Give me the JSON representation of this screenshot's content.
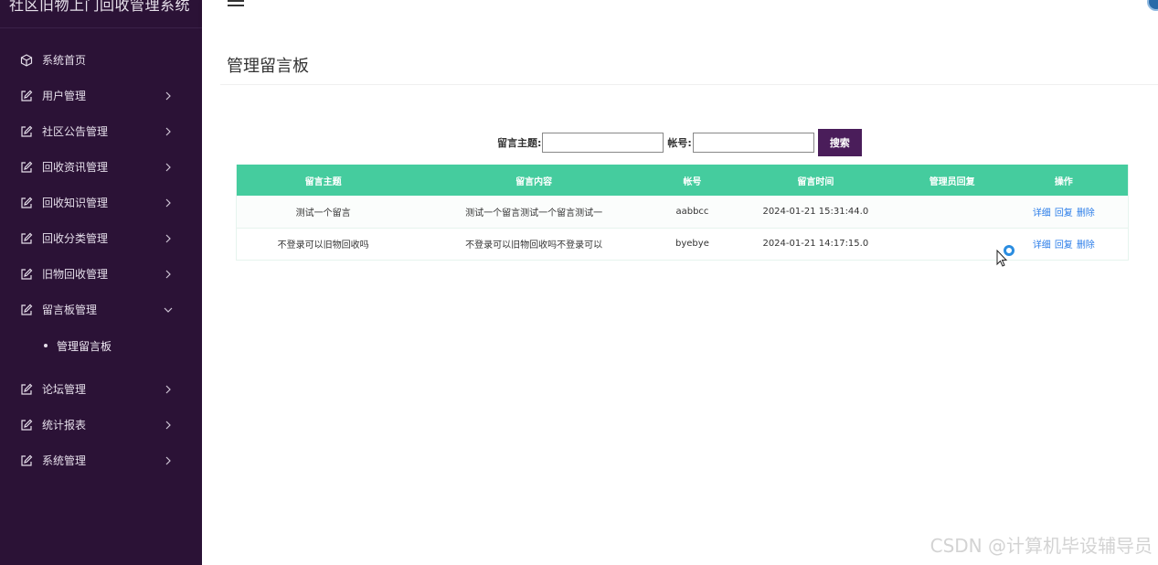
{
  "app": {
    "title": "社区旧物上门回收管理系统"
  },
  "sidebar": {
    "items": [
      {
        "label": "系统首页",
        "icon": "cube-icon",
        "expandable": false
      },
      {
        "label": "用户管理",
        "icon": "edit-icon",
        "expandable": true
      },
      {
        "label": "社区公告管理",
        "icon": "edit-icon",
        "expandable": true
      },
      {
        "label": "回收资讯管理",
        "icon": "edit-icon",
        "expandable": true
      },
      {
        "label": "回收知识管理",
        "icon": "edit-icon",
        "expandable": true
      },
      {
        "label": "回收分类管理",
        "icon": "edit-icon",
        "expandable": true
      },
      {
        "label": "旧物回收管理",
        "icon": "edit-icon",
        "expandable": true
      },
      {
        "label": "留言板管理",
        "icon": "edit-icon",
        "expandable": true,
        "expanded": true
      },
      {
        "label": "论坛管理",
        "icon": "edit-icon",
        "expandable": true
      },
      {
        "label": "统计报表",
        "icon": "edit-icon",
        "expandable": true
      },
      {
        "label": "系统管理",
        "icon": "edit-icon",
        "expandable": true
      }
    ],
    "submenu": {
      "label": "管理留言板"
    }
  },
  "page": {
    "title": "管理留言板"
  },
  "search": {
    "subject_label": "留言主题:",
    "account_label": "帐号:",
    "subject_value": "",
    "account_value": "",
    "button_label": "搜索"
  },
  "table": {
    "headers": [
      "留言主题",
      "留言内容",
      "帐号",
      "留言时间",
      "管理员回复",
      "操作"
    ],
    "rows": [
      {
        "subject": "测试一个留言",
        "content": "测试一个留言测试一个留言测试一",
        "account": "aabbcc",
        "time": "2024-01-21 15:31:44.0",
        "reply": ""
      },
      {
        "subject": "不登录可以旧物回收吗",
        "content": "不登录可以旧物回收吗不登录可以",
        "account": "byebye",
        "time": "2024-01-21 14:17:15.0",
        "reply": ""
      }
    ],
    "actions": {
      "detail": "详细",
      "reply": "回复",
      "delete": "删除"
    }
  },
  "colors": {
    "sidebar_bg": "#2b1236",
    "table_header_bg": "#45cc9e",
    "search_button_bg": "#4a1d5a",
    "link": "#2b7de9"
  },
  "watermark": "CSDN @计算机毕设辅导员"
}
